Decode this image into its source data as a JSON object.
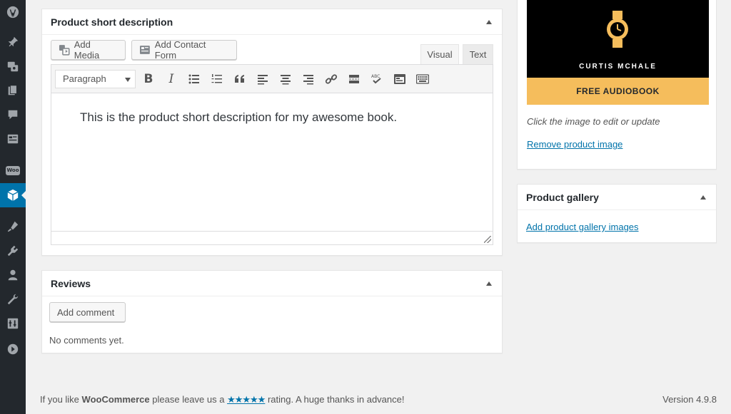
{
  "short_description_box": {
    "title": "Product short description",
    "add_media_label": "Add Media",
    "add_contact_form_label": "Add Contact Form",
    "tab_visual": "Visual",
    "tab_text": "Text",
    "format_select_value": "Paragraph",
    "toolbar_icons": [
      "bold-icon",
      "italic-icon",
      "bulleted-list-icon",
      "numbered-list-icon",
      "blockquote-icon",
      "align-left-icon",
      "align-center-icon",
      "align-right-icon",
      "link-icon",
      "read-more-icon",
      "spellcheck-icon",
      "product-embed-icon",
      "keyboard-icon"
    ],
    "content": "This is the product short description for my awesome book."
  },
  "reviews_box": {
    "title": "Reviews",
    "add_comment_label": "Add comment",
    "empty_text": "No comments yet."
  },
  "product_image_box": {
    "cover_author": "CURTIS MCHALE",
    "cover_band": "FREE AUDIOBOOK",
    "hint": "Click the image to edit or update",
    "remove_link": "Remove product image"
  },
  "product_gallery_box": {
    "title": "Product gallery",
    "add_link": "Add product gallery images"
  },
  "footer": {
    "prefix": "If you like ",
    "brand": "WooCommerce",
    "middle": " please leave us a ",
    "stars": "★★★★★",
    "suffix": " rating. A huge thanks in advance!",
    "version": "Version 4.9.8"
  },
  "sidebar_icons": [
    "wordpress-logo-icon",
    "posts-pin-icon",
    "media-icon",
    "pages-icon",
    "comments-icon",
    "forms-icon",
    "woocommerce-icon",
    "products-icon",
    "appearance-icon",
    "plugins-icon",
    "users-icon",
    "tools-icon",
    "settings-icon",
    "collapse-menu-icon"
  ],
  "colors": {
    "accent": "#0073aa",
    "sidebar_bg": "#23282d",
    "cover_band": "#f5bd5c"
  }
}
